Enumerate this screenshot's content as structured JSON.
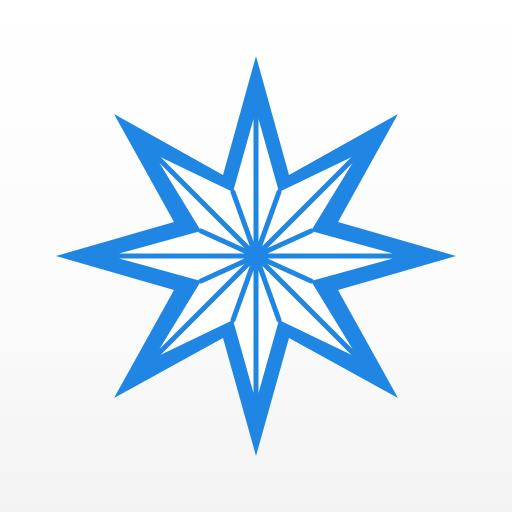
{
  "icon": {
    "symbol": "eight-point-star-icon",
    "colors": {
      "star": "#1f86e3",
      "background_top": "#ffffff",
      "background_bottom": "#f3f3f3"
    }
  }
}
